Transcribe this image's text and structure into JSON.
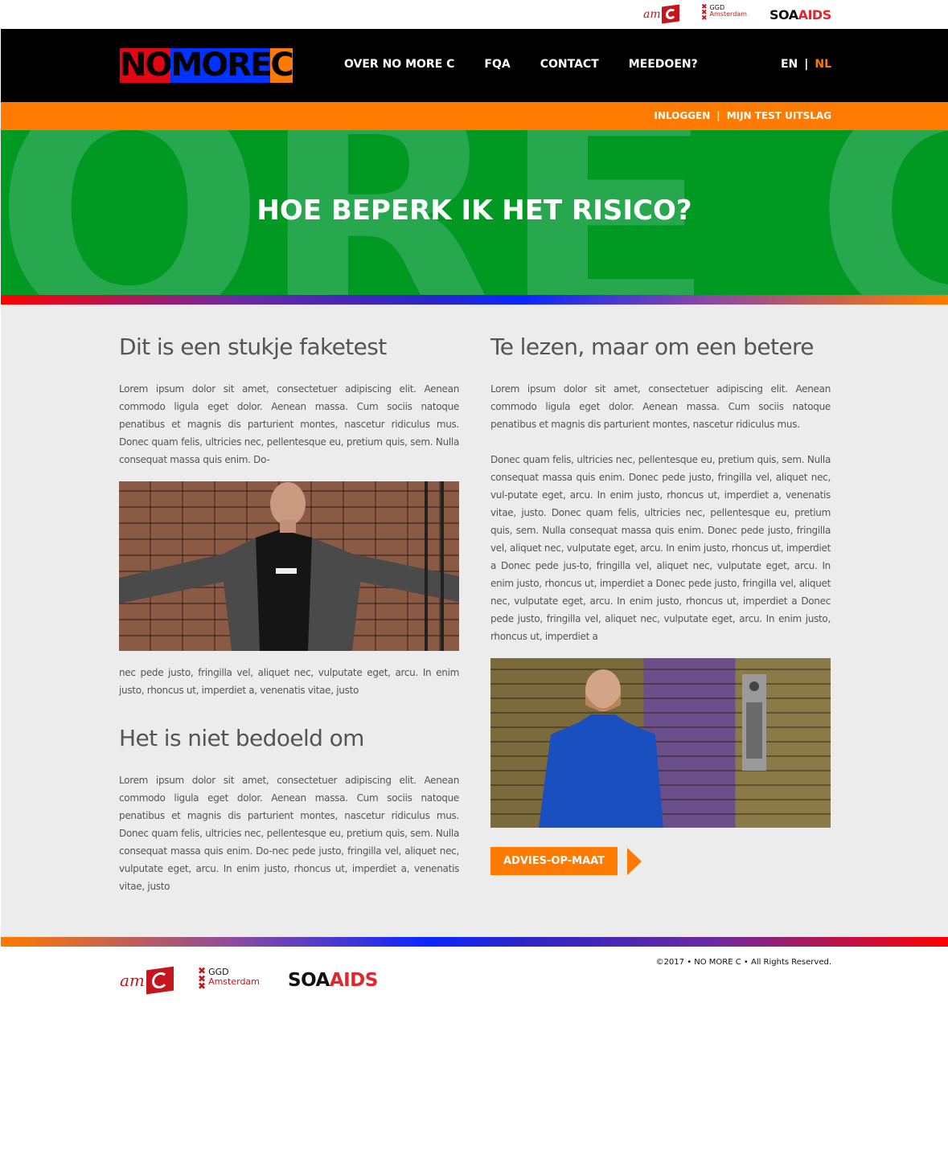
{
  "partners": {
    "amc": "am",
    "ggd_line1": "GGD",
    "ggd_line2": "Amsterdam",
    "soa": "SOA",
    "aids": "AIDS"
  },
  "brand": {
    "letters": [
      {
        "char": "NO",
        "bg": "#e30613",
        "fg": "#000000"
      },
      {
        "char": "MO",
        "bg": "#0033ff",
        "fg": "#000000"
      },
      {
        "char": "RE",
        "bg": "#0033ff",
        "fg": "#000000"
      },
      {
        "char": "C",
        "bg": "#ff7a00",
        "fg": "#000000"
      }
    ]
  },
  "nav": {
    "items": [
      "OVER NO MORE C",
      "FQA",
      "CONTACT",
      "MEEDOEN?"
    ]
  },
  "lang": {
    "en": "EN",
    "sep": "|",
    "nl": "NL"
  },
  "subbar": {
    "login": "INLOGGEN",
    "sep": "|",
    "result": "MIJN TEST UITSLAG"
  },
  "hero": {
    "bg_text": "ORE C",
    "title": "HOE BEPERK IK HET RISICO?"
  },
  "left": {
    "heading1": "Dit is een stukje faketest",
    "para1": "Lorem ipsum dolor sit amet, consectetuer adipiscing elit. Aenean commodo ligula eget dolor. Aenean massa. Cum sociis natoque penatibus et magnis dis parturient montes, nascetur ridiculus mus. Donec quam felis, ultricies nec, pellentesque eu, pretium quis, sem. Nulla consequat massa quis enim. Do-",
    "para2": "nec pede justo, fringilla vel, aliquet nec, vulputate eget, arcu. In enim justo, rhoncus ut, imperdiet a, venenatis vitae, justo",
    "heading2": "Het is niet bedoeld om",
    "para3": "Lorem ipsum dolor sit amet, consectetuer adipiscing elit. Aenean commodo ligula eget dolor. Aenean massa. Cum sociis natoque penatibus et magnis dis parturient montes, nascetur ridiculus mus. Donec quam felis, ultricies nec, pellentesque eu, pretium quis, sem. Nulla consequat massa quis enim. Do-nec pede justo, fringilla vel, aliquet nec, vulputate eget, arcu. In enim justo, rhoncus ut, imperdiet a, venenatis vitae, justo"
  },
  "right": {
    "heading1": "Te lezen, maar om een betere",
    "para1": "Lorem ipsum dolor sit amet, consectetuer adipiscing elit. Aenean commodo ligula eget dolor. Aenean massa. Cum sociis natoque penatibus et magnis dis parturient montes, nascetur ridiculus mus.",
    "para2": "Donec quam felis, ultricies nec, pellentesque eu, pretium quis, sem. Nulla consequat massa quis enim. Donec pede justo, fringilla vel, aliquet nec, vul-putate eget, arcu. In enim justo, rhoncus ut, imperdiet a, venenatis vitae, justo. Donec quam felis, ultricies nec, pellentesque eu, pretium quis, sem. Nulla consequat massa quis enim. Donec pede justo, fringilla vel, aliquet nec, vulputate eget, arcu. In enim justo, rhoncus ut, imperdiet a Donec pede jus-to, fringilla vel, aliquet nec, vulputate eget, arcu. In enim justo, rhoncus ut, imperdiet a Donec pede justo, fringilla vel, aliquet nec, vulputate eget, arcu. In enim justo, rhoncus ut, imperdiet a Donec pede justo, fringilla vel, aliquet nec, vulputate eget, arcu. In enim justo, rhoncus ut, imperdiet a",
    "button": "ADVIES-OP-MAAT"
  },
  "footer": {
    "copyright": "©2017 • NO MORE C  • All Rights Reserved."
  },
  "colors": {
    "orange": "#ff7a00",
    "black": "#000000",
    "green": "#009922",
    "red": "#e30613",
    "blue": "#0033ff"
  }
}
